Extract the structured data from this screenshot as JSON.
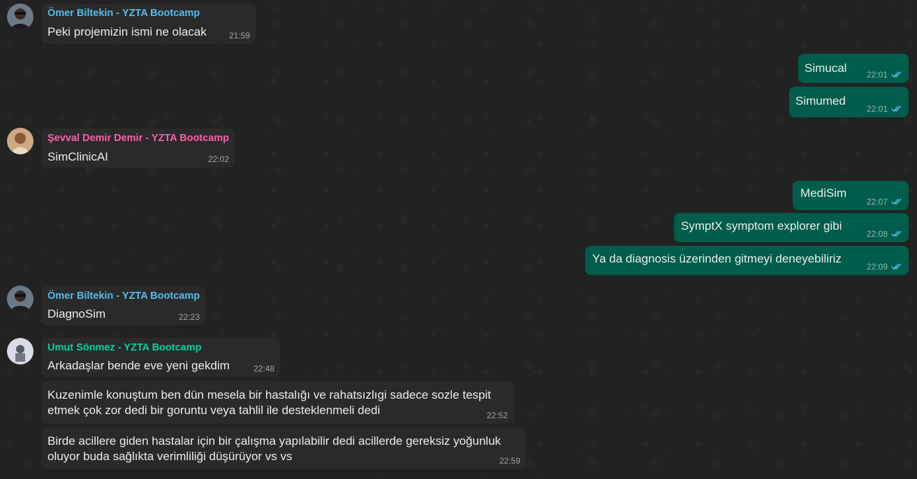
{
  "chat": {
    "messages": [
      {
        "sender": "Ömer Biltekin - YZTA Bootcamp",
        "sender_color": "#53bdeb",
        "text": "Peki projemizin ismi ne olacak",
        "time": "21:59"
      },
      {
        "text": "Simucal",
        "time": "22:01"
      },
      {
        "text": "Simumed",
        "time": "22:01"
      },
      {
        "sender": "Şevval Demir Demir - YZTA Bootcamp",
        "sender_color": "#ff5caa",
        "text": "SimClinicAI",
        "time": "22:02"
      },
      {
        "text": "MediSim",
        "time": "22:07"
      },
      {
        "text": "SymptX symptom explorer gibi",
        "time": "22:08"
      },
      {
        "text": "Ya da diagnosis üzerinden gitmeyi deneyebiliriz",
        "time": "22:09"
      },
      {
        "sender": "Ömer Biltekin - YZTA Bootcamp",
        "sender_color": "#53bdeb",
        "text": "DiagnoSim",
        "time": "22:23"
      },
      {
        "sender": "Umut Sönmez - YZTA Bootcamp",
        "sender_color": "#06cf9c",
        "text": "Arkadaşlar bende eve yeni gekdim",
        "time": "22:48"
      },
      {
        "text": "Kuzenimle konuştum ben dün mesela bir hastalığı ve rahatsızlıgi sadece sozle tespit etmek çok zor dedi bir goruntu veya tahlil ile desteklenmeli dedi",
        "time": "22:52"
      },
      {
        "text": "Birde acillere giden hastalar için bir çalışma yapılabilir dedi acillerde gereksiz yoğunluk oluyor buda sağlıkta verimliliği düşürüyor vs vs",
        "time": "22:59"
      }
    ]
  },
  "colors": {
    "incoming_bubble": "#2a2a2a",
    "outgoing_bubble": "#005c4b",
    "read_tick": "#53bdeb"
  }
}
